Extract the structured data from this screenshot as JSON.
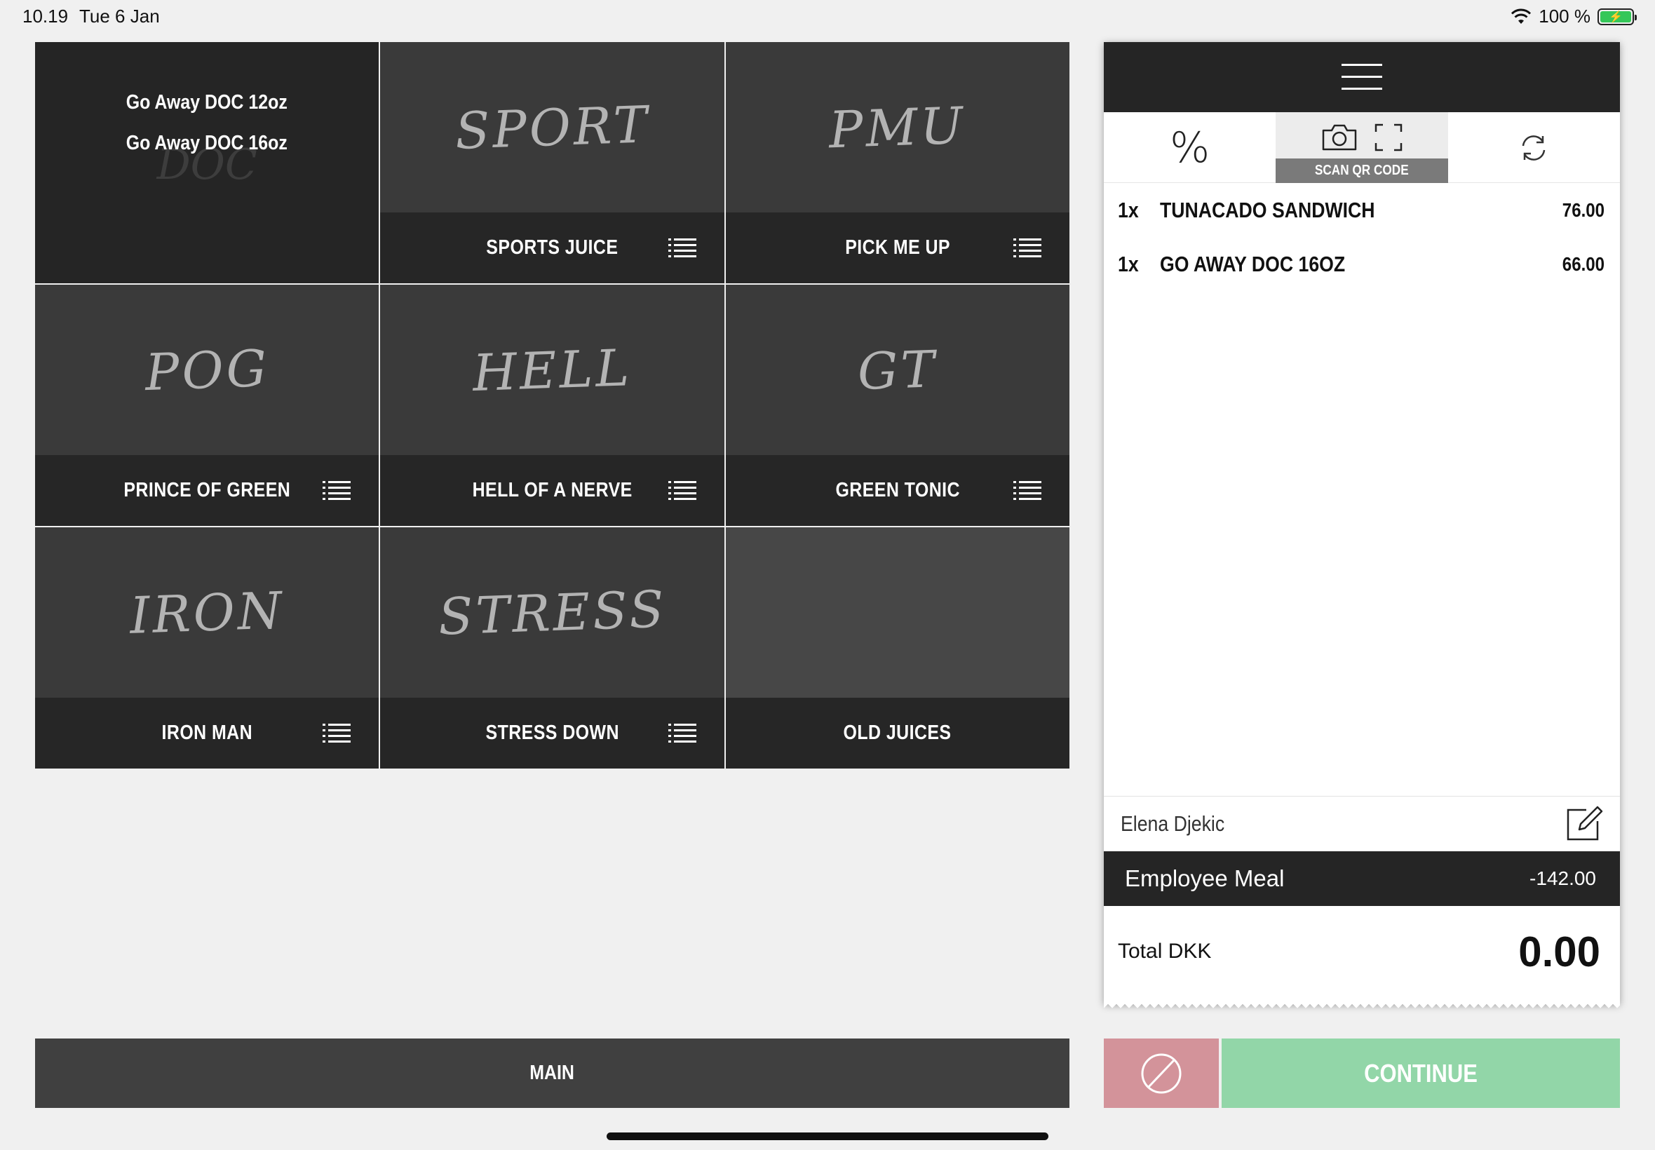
{
  "status_bar": {
    "time": "10.19",
    "date": "Tue 6 Jan",
    "battery": "100 %"
  },
  "grid": {
    "split_tile": {
      "top_label": "Go Away DOC 12oz",
      "bottom_label": "Go Away DOC 16oz",
      "ghost_art": "DOC"
    },
    "tiles": [
      {
        "art": "SPORT",
        "label": "SPORTS JUICE"
      },
      {
        "art": "PMU",
        "label": "PICK ME UP"
      },
      {
        "art": "POG",
        "label": "PRINCE OF GREEN"
      },
      {
        "art": "HELL",
        "label": "HELL OF A NERVE"
      },
      {
        "art": "GT",
        "label": "GREEN TONIC"
      },
      {
        "art": "IRON",
        "label": "IRON MAN"
      },
      {
        "art": "STRESS",
        "label": "STRESS DOWN"
      },
      {
        "art": "",
        "label": "OLD JUICES"
      }
    ]
  },
  "bottom": {
    "main_label": "MAIN",
    "continue_label": "CONTINUE"
  },
  "order": {
    "scan_label": "SCAN QR CODE",
    "percent_symbol": "%",
    "items": [
      {
        "qty": "1x",
        "name": "TUNACADO SANDWICH",
        "price": "76.00"
      },
      {
        "qty": "1x",
        "name": "GO AWAY DOC 16OZ",
        "price": "66.00"
      }
    ],
    "customer": "Elena Djekic",
    "discount": {
      "label": "Employee Meal",
      "amount": "-142.00"
    },
    "total": {
      "label": "Total DKK",
      "value": "0.00"
    }
  },
  "colors": {
    "cancel": "#d3939a",
    "continue": "#92d6a8",
    "dark": "#252525"
  }
}
